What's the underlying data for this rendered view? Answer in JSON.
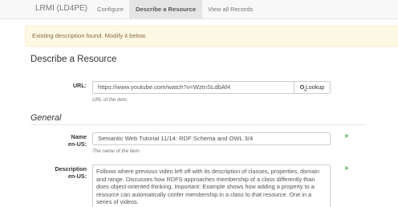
{
  "navbar": {
    "brand": "LRMI (LD4PE)",
    "links": [
      "Configure",
      "Describe a Resource",
      "View all Records"
    ]
  },
  "alert": "Existing description found. Modify it below.",
  "page_title": "Describe a Resource",
  "url_field": {
    "label": "URL:",
    "value": "https://www.youtube.com/watch?v=WztnSLdbAf4",
    "button": "Lookup",
    "help": "URL of the item."
  },
  "section": "General",
  "name_field": {
    "label_line1": "Name",
    "label_line2": "en-US:",
    "value": "Semantic Web Tutorial 11/14: RDF Schema and OWL 3/4",
    "help": "The name of the item."
  },
  "description_field": {
    "label_line1": "Description",
    "label_line2": "en-US:",
    "value": "Follows where previous video left off with its description of classes, properties, domain and range.  Discusses how RDFS approaches membership of a class differently than does object-oriented thinking.  Important: Example shows how adding a property to a resource can automatically confer membership in a class to that resource.  One in a series of videos."
  },
  "add_symbol": "+",
  "colors": {
    "accent_add": "#5cb85c",
    "alert_bg": "#fcf8e3",
    "alert_text": "#8a6d3b"
  },
  "icons": {
    "lookup": "search-icon",
    "add": "plus-icon"
  }
}
